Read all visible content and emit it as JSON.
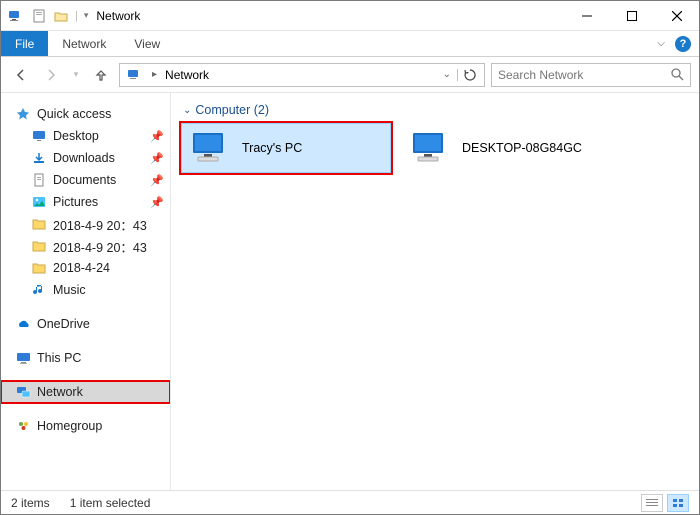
{
  "title": "Network",
  "ribbon": {
    "file": "File",
    "network": "Network",
    "view": "View"
  },
  "address": {
    "location": "Network"
  },
  "search": {
    "placeholder": "Search Network"
  },
  "nav": {
    "quickAccess": "Quick access",
    "desktop": "Desktop",
    "downloads": "Downloads",
    "documents": "Documents",
    "pictures": "Pictures",
    "folder1": "2018-4-9 20：43",
    "folder2": "2018-4-9 20：43",
    "folder3": "2018-4-24",
    "music": "Music",
    "onedrive": "OneDrive",
    "thispc": "This PC",
    "network": "Network",
    "homegroup": "Homegroup"
  },
  "content": {
    "groupHeader": "Computer (2)",
    "items": [
      {
        "label": "Tracy's  PC"
      },
      {
        "label": "DESKTOP-08G84GC"
      }
    ]
  },
  "status": {
    "count": "2 items",
    "selected": "1 item selected"
  }
}
